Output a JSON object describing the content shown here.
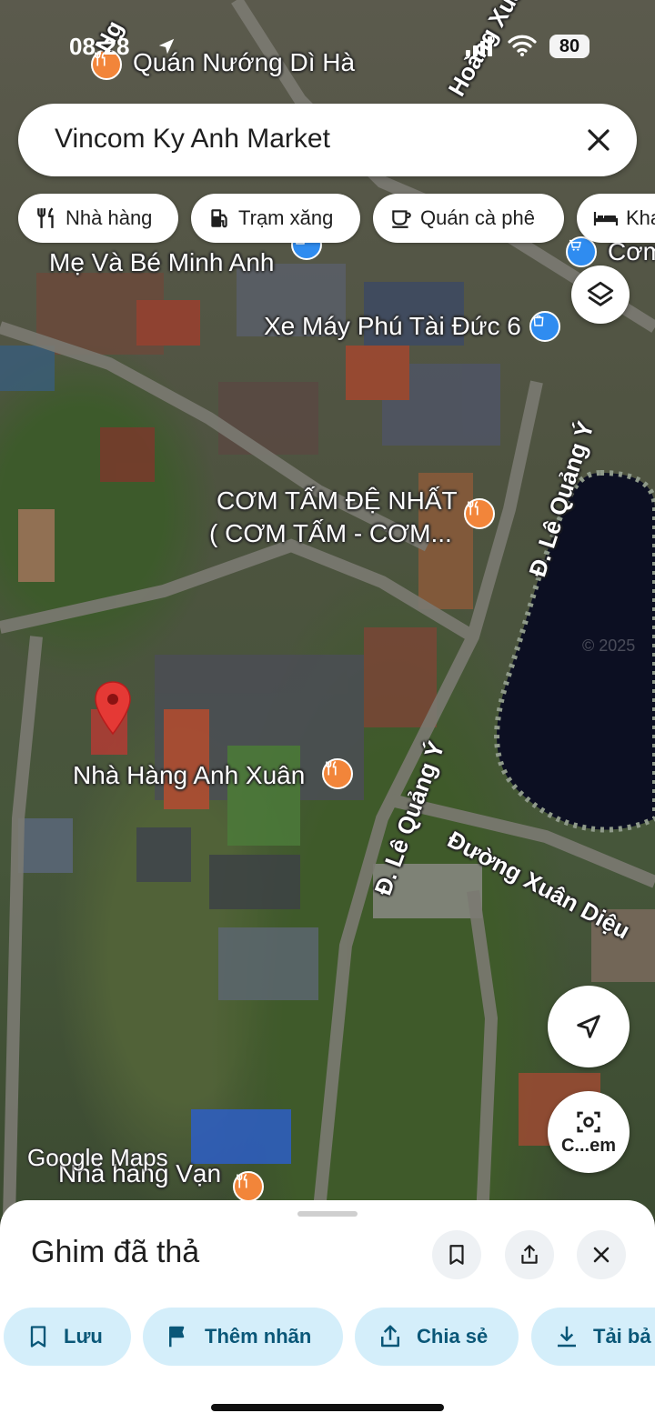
{
  "status_bar": {
    "time": "08:28",
    "battery": "80"
  },
  "search": {
    "value": "Vincom Ky Anh Market"
  },
  "chips": [
    {
      "label": "Nhà hàng",
      "icon": "restaurant-icon"
    },
    {
      "label": "Trạm xăng",
      "icon": "gas-station-icon"
    },
    {
      "label": "Quán cà phê",
      "icon": "coffee-icon"
    },
    {
      "label": "Kha",
      "icon": "hotel-icon"
    }
  ],
  "map": {
    "pois": [
      "Quán Nướng Dì Hà",
      "Mẹ Và Bé Minh Anh",
      "Xe Máy Phú Tài Đức 6",
      "CƠM TẤM ĐỆ NHẤT",
      "( CƠM TẤM - CƠM...",
      "Nhà Hàng Anh Xuân",
      "Nhà hàng Vạn",
      "Cơm"
    ],
    "roads": [
      "Ng",
      "Đ. Lê Quảng Ý",
      "Đ. Lê Quảng Ý",
      "Đường Xuân Diệu",
      "Hoàng Xuân"
    ],
    "attribution": "Google Maps",
    "watermark": "© 2025",
    "street_view_label": "C...em"
  },
  "sheet": {
    "title": "Ghim đã thả",
    "actions": [
      {
        "label": "Lưu"
      },
      {
        "label": "Thêm nhãn"
      },
      {
        "label": "Chia sẻ"
      },
      {
        "label": "Tải bả"
      }
    ]
  },
  "colors": {
    "accent_chip_bg": "#d4eefa",
    "accent_chip_text": "#0a5778",
    "pin_red": "#e53935",
    "poi_orange": "#f2853a",
    "poi_blue": "#2f8cf0"
  }
}
